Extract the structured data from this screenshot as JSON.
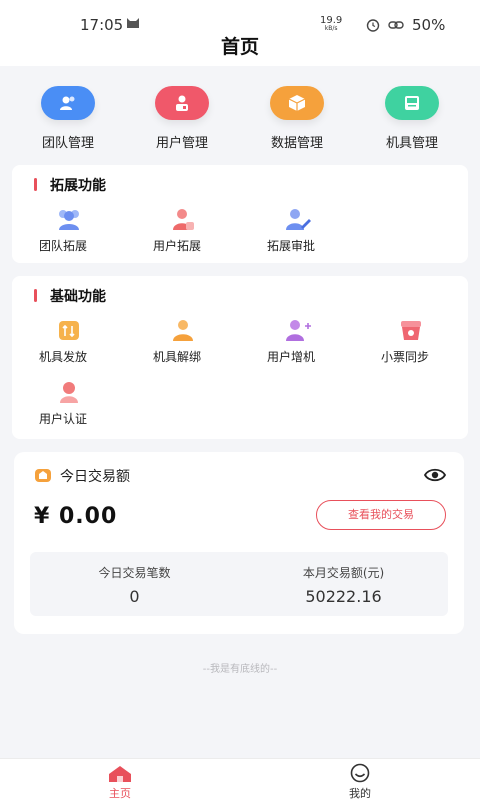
{
  "status_bar": {
    "time": "17:05",
    "net_speed_value": "19.9",
    "net_speed_unit": "kB/s",
    "battery": "50%"
  },
  "header": {
    "title": "首页"
  },
  "top_actions": [
    {
      "label": "团队管理",
      "icon": "team-icon",
      "color": "#4a8ef5"
    },
    {
      "label": "用户管理",
      "icon": "user-manage-icon",
      "color": "#f0586a"
    },
    {
      "label": "数据管理",
      "icon": "data-box-icon",
      "color": "#f5a13c"
    },
    {
      "label": "机具管理",
      "icon": "pos-icon",
      "color": "#3fd2a0"
    }
  ],
  "extend_section": {
    "title": "拓展功能",
    "items": [
      {
        "label": "团队拓展",
        "icon": "team-extend-icon"
      },
      {
        "label": "用户拓展",
        "icon": "user-extend-icon"
      },
      {
        "label": "拓展审批",
        "icon": "approval-icon"
      }
    ]
  },
  "basic_section": {
    "title": "基础功能",
    "items": [
      {
        "label": "机具发放",
        "icon": "distribute-icon"
      },
      {
        "label": "机具解绑",
        "icon": "unbind-icon"
      },
      {
        "label": "用户增机",
        "icon": "user-add-device-icon"
      },
      {
        "label": "小票同步",
        "icon": "receipt-sync-icon"
      },
      {
        "label": "用户认证",
        "icon": "user-verify-icon"
      }
    ]
  },
  "transactions": {
    "title": "今日交易额",
    "amount": "¥ 0.00",
    "view_button": "查看我的交易",
    "today_count_label": "今日交易笔数",
    "today_count_value": "0",
    "month_amount_label": "本月交易额(元)",
    "month_amount_value": "50222.16"
  },
  "bottom_note": "--我是有底线的--",
  "tabbar": {
    "home": "主页",
    "mine": "我的",
    "active_color": "#e8505b",
    "inactive_color": "#333333"
  }
}
